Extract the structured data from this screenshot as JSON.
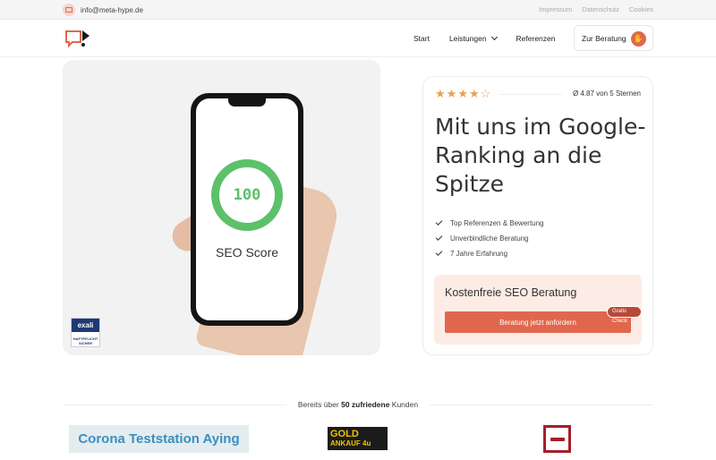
{
  "topbar": {
    "email": "info@meta-hype.de",
    "links": [
      "Impressum",
      "Datenschutz",
      "Cookies"
    ]
  },
  "nav": {
    "items": [
      "Start",
      "Leistungen",
      "Referenzen"
    ],
    "cta": "Zur Beratung"
  },
  "hero_image": {
    "score_value": "100",
    "score_label": "SEO Score",
    "badge_brand": "exali",
    "badge_text": "HAFTPFLICHT SICHER"
  },
  "card": {
    "rating_value": 4.87,
    "rating_max": 5,
    "rating_text": "Ø 4.87 von 5 Sternen",
    "headline": "Mit uns im Google-Ranking an die Spitze",
    "checks": [
      "Top Referenzen & Bewertung",
      "Unverbindliche Beratung",
      "7 Jahre Erfahrung"
    ],
    "offer_title": "Kostenfreie SEO Beratung",
    "offer_button": "Beratung jetzt anfordern",
    "offer_badge": "Gratis Check"
  },
  "customers": {
    "text_prefix": "Bereits über ",
    "text_bold": "50 zufriedene",
    "text_suffix": " Kunden",
    "logo1": "Corona Teststation Aying",
    "logo2_line1": "GOLD",
    "logo2_line2": "ANKAUF 4u"
  },
  "colors": {
    "accent": "#e0674c",
    "star": "#e8a04d",
    "score_green": "#5cc16a"
  }
}
